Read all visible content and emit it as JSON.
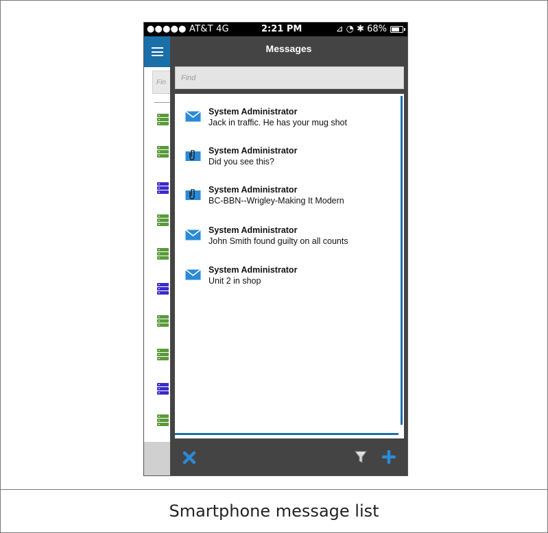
{
  "status_bar": {
    "carrier": "●●●●● AT&T  4G",
    "time": "2:21 PM",
    "battery": "68%"
  },
  "background_app": {
    "find_placeholder": "Fin",
    "row_icons": [
      "green",
      "green",
      "blue",
      "green",
      "green",
      "blue",
      "green",
      "green",
      "blue",
      "green"
    ]
  },
  "panel": {
    "title": "Messages",
    "find_placeholder": "Find"
  },
  "messages": [
    {
      "sender": "System Administrator",
      "subject": "Jack in traffic. He has your mug shot",
      "icon": "envelope-icon"
    },
    {
      "sender": "System Administrator",
      "subject": "Did you see this?",
      "icon": "attachment-icon"
    },
    {
      "sender": "System Administrator",
      "subject": "BC-BBN--Wrigley-Making It Modern",
      "icon": "attachment-icon"
    },
    {
      "sender": "System Administrator",
      "subject": "John Smith found guilty on all counts",
      "icon": "envelope-icon"
    },
    {
      "sender": "System Administrator",
      "subject": "Unit 2 in shop",
      "icon": "envelope-icon"
    }
  ],
  "footer": {
    "close_icon": "close-icon",
    "filter_icon": "filter-icon",
    "add_icon": "add-icon"
  },
  "caption": "Smartphone message list",
  "colors": {
    "accent": "#1a6fa8",
    "panel": "#444444",
    "icon_blue": "#2b8ad6"
  }
}
